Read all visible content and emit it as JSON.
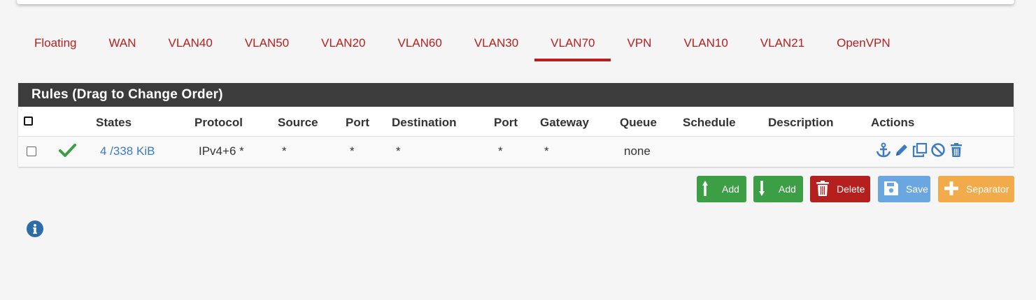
{
  "tabs": [
    {
      "label": "Floating"
    },
    {
      "label": "WAN"
    },
    {
      "label": "VLAN40"
    },
    {
      "label": "VLAN50"
    },
    {
      "label": "VLAN20"
    },
    {
      "label": "VLAN60"
    },
    {
      "label": "VLAN30"
    },
    {
      "label": "VLAN70",
      "active": true
    },
    {
      "label": "VPN"
    },
    {
      "label": "VLAN10"
    },
    {
      "label": "VLAN21"
    },
    {
      "label": "OpenVPN"
    }
  ],
  "panel": {
    "title": "Rules (Drag to Change Order)",
    "columns": {
      "states": "States",
      "protocol": "Protocol",
      "source": "Source",
      "port": "Port",
      "destination": "Destination",
      "port2": "Port",
      "gateway": "Gateway",
      "queue": "Queue",
      "schedule": "Schedule",
      "description": "Description",
      "actions": "Actions"
    },
    "rows": [
      {
        "states": "4 /338 KiB",
        "protocol": "IPv4+6 *",
        "source": "*",
        "port": "*",
        "destination": "*",
        "port2": "*",
        "gateway": "*",
        "queue": "none",
        "schedule": "",
        "description": ""
      }
    ],
    "action_icons": [
      "anchor-icon",
      "pencil-icon",
      "copy-icon",
      "ban-icon",
      "trash-icon"
    ]
  },
  "buttons": {
    "add_top": "Add",
    "add_bottom": "Add",
    "delete": "Delete",
    "save": "Save",
    "separator": "Separator"
  },
  "colors": {
    "accent_red": "#b5201e",
    "link_blue": "#3b7bbf",
    "success_green": "#3c9e45",
    "save_blue": "#6aa7e0",
    "separator_orange": "#f2ab4a"
  }
}
